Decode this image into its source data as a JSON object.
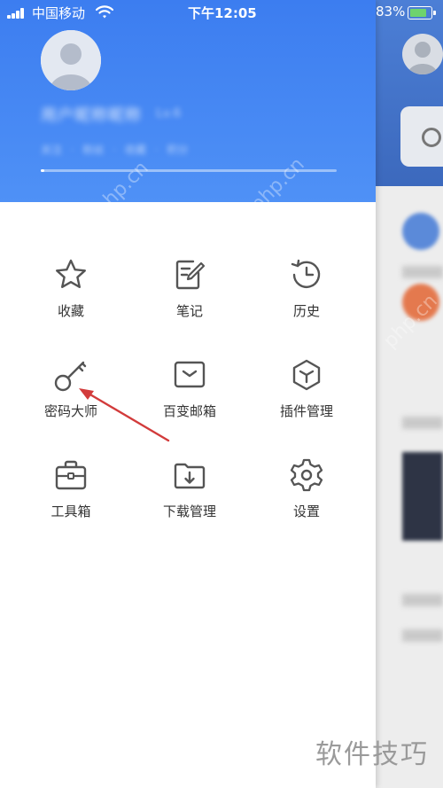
{
  "status_bar": {
    "carrier": "中国移动",
    "time": "下午12:05",
    "battery": "83%",
    "battery_level": 0.83
  },
  "profile": {
    "username": "用户昵称昵称",
    "level": "Lv.6",
    "stats": "关注 · 粉丝 · 收藏 · 积分",
    "progress": 0.01
  },
  "menu": [
    {
      "label": "收藏",
      "icon": "star-icon"
    },
    {
      "label": "笔记",
      "icon": "note-icon"
    },
    {
      "label": "历史",
      "icon": "history-icon"
    },
    {
      "label": "密码大师",
      "icon": "key-icon"
    },
    {
      "label": "百变邮箱",
      "icon": "mail-icon"
    },
    {
      "label": "插件管理",
      "icon": "plugin-cube-icon"
    },
    {
      "label": "工具箱",
      "icon": "toolbox-icon"
    },
    {
      "label": "下载管理",
      "icon": "download-folder-icon"
    },
    {
      "label": "设置",
      "icon": "gear-icon"
    }
  ],
  "watermark": "软件技巧",
  "overlay_watermark": "php.cn",
  "colors": {
    "header": "#4a8ef5",
    "icon_stroke": "#555555",
    "annotation_arrow": "#d23b3b"
  }
}
